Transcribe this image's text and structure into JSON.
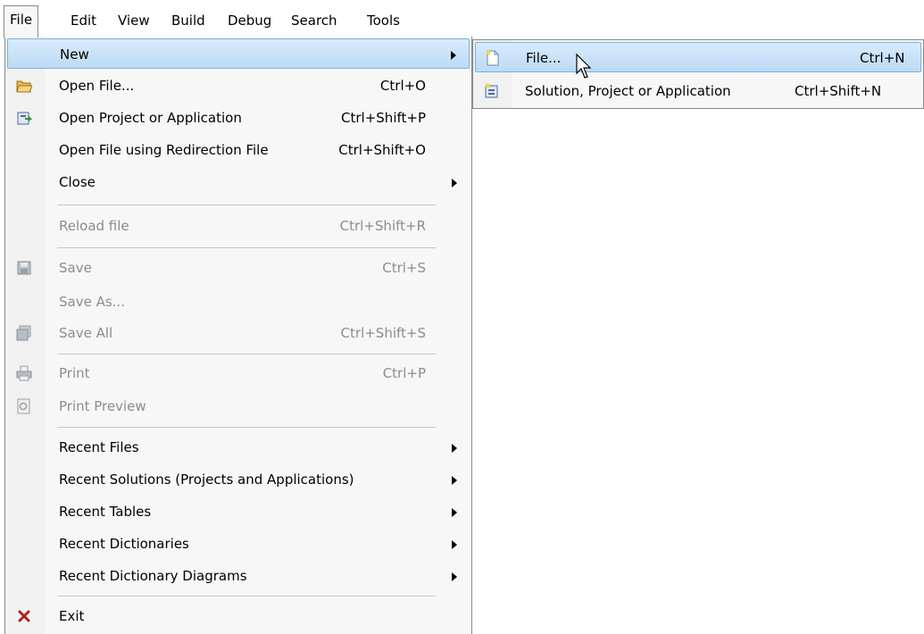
{
  "menubar": [
    {
      "label": "File",
      "active": true
    },
    {
      "label": "Edit"
    },
    {
      "label": "View"
    },
    {
      "label": "Build"
    },
    {
      "label": "Debug"
    },
    {
      "label": "Search"
    },
    {
      "label": "Tools"
    }
  ],
  "file_menu": {
    "items": [
      {
        "label": "New",
        "shortcut": "",
        "submenu": true,
        "highlighted": true,
        "icon": ""
      },
      {
        "label": "Open File...",
        "shortcut": "Ctrl+O",
        "icon": "open-folder-icon"
      },
      {
        "label": "Open Project or Application",
        "shortcut": "Ctrl+Shift+P",
        "icon": "open-project-icon"
      },
      {
        "label": "Open File using Redirection File",
        "shortcut": "Ctrl+Shift+O"
      },
      {
        "label": "Close",
        "shortcut": "",
        "submenu": true
      },
      {
        "label": "Reload file",
        "shortcut": "Ctrl+Shift+R",
        "disabled": true
      },
      {
        "label": "Save",
        "shortcut": "Ctrl+S",
        "disabled": true,
        "icon": "save-icon"
      },
      {
        "label": "Save As...",
        "shortcut": "",
        "disabled": true
      },
      {
        "label": "Save All",
        "shortcut": "Ctrl+Shift+S",
        "disabled": true,
        "icon": "save-all-icon"
      },
      {
        "label": "Print",
        "shortcut": "Ctrl+P",
        "disabled": true,
        "icon": "print-icon"
      },
      {
        "label": "Print Preview",
        "shortcut": "",
        "disabled": true,
        "icon": "print-preview-icon"
      },
      {
        "label": "Recent Files",
        "submenu": true
      },
      {
        "label": "Recent Solutions (Projects and Applications)",
        "submenu": true
      },
      {
        "label": "Recent Tables",
        "submenu": true
      },
      {
        "label": "Recent Dictionaries",
        "submenu": true
      },
      {
        "label": "Recent Dictionary Diagrams",
        "submenu": true
      },
      {
        "label": "Exit",
        "icon": "exit-icon"
      }
    ]
  },
  "new_submenu": {
    "items": [
      {
        "label": "File...",
        "shortcut": "Ctrl+N",
        "highlighted": true,
        "icon": "new-file-icon"
      },
      {
        "label": "Solution, Project or Application",
        "shortcut": "Ctrl+Shift+N",
        "icon": "new-solution-icon"
      }
    ]
  },
  "colors": {
    "highlight": "#c6e0f8",
    "menu_bg": "#f7f7f7",
    "disabled_text": "#8c8c8c"
  }
}
